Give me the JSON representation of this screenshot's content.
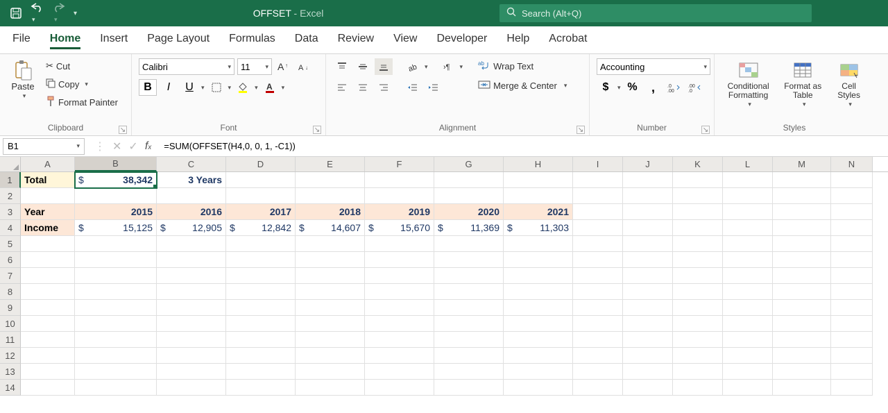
{
  "title": {
    "doc": "OFFSET",
    "sep": "  -  ",
    "app": "Excel"
  },
  "search": {
    "placeholder": "Search (Alt+Q)"
  },
  "tabs": [
    "File",
    "Home",
    "Insert",
    "Page Layout",
    "Formulas",
    "Data",
    "Review",
    "View",
    "Developer",
    "Help",
    "Acrobat"
  ],
  "active_tab": "Home",
  "clipboard": {
    "paste": "Paste",
    "cut": "Cut",
    "copy": "Copy",
    "format_painter": "Format Painter",
    "label": "Clipboard"
  },
  "font": {
    "name": "Calibri",
    "size": "11",
    "label": "Font"
  },
  "alignment": {
    "wrap": "Wrap Text",
    "merge": "Merge & Center",
    "label": "Alignment"
  },
  "number": {
    "format": "Accounting",
    "label": "Number"
  },
  "styles": {
    "cond": "Conditional Formatting",
    "table": "Format as Table",
    "cell": "Cell Styles",
    "label": "Styles"
  },
  "fbar": {
    "name": "B1",
    "formula": "=SUM(OFFSET(H4,0, 0, 1, -C1))"
  },
  "cols": [
    "A",
    "B",
    "C",
    "D",
    "E",
    "F",
    "G",
    "H",
    "I",
    "J",
    "K",
    "L",
    "M",
    "N"
  ],
  "rows": [
    "1",
    "2",
    "3",
    "4",
    "5",
    "6",
    "7",
    "8",
    "9",
    "10",
    "11",
    "12",
    "13",
    "14"
  ],
  "sheet": {
    "r1": {
      "A": "Total",
      "B": {
        "sym": "$",
        "val": "38,342"
      },
      "C": "3 Years"
    },
    "r3": {
      "A": "Year",
      "B": "2015",
      "C": "2016",
      "D": "2017",
      "E": "2018",
      "F": "2019",
      "G": "2020",
      "H": "2021"
    },
    "r4": {
      "A": "Income",
      "B": {
        "sym": "$",
        "val": "15,125"
      },
      "C": {
        "sym": "$",
        "val": "12,905"
      },
      "D": {
        "sym": "$",
        "val": "12,842"
      },
      "E": {
        "sym": "$",
        "val": "14,607"
      },
      "F": {
        "sym": "$",
        "val": "15,670"
      },
      "G": {
        "sym": "$",
        "val": "11,369"
      },
      "H": {
        "sym": "$",
        "val": "11,303"
      }
    }
  },
  "selected_cell": "B1",
  "chart_data": {
    "type": "table",
    "title": "OFFSET sum of last N years income",
    "categories": [
      "2015",
      "2016",
      "2017",
      "2018",
      "2019",
      "2020",
      "2021"
    ],
    "series": [
      {
        "name": "Income",
        "values": [
          15125,
          12905,
          12842,
          14607,
          15670,
          11369,
          11303
        ]
      }
    ],
    "derived": {
      "years": 3,
      "total": 38342
    }
  }
}
